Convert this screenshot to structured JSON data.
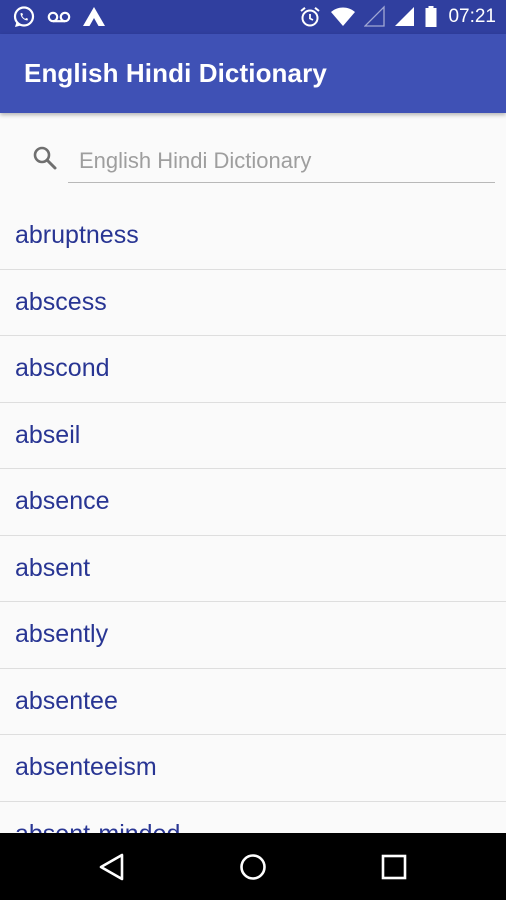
{
  "status_bar": {
    "time": "07:21",
    "left_icons": [
      "whatsapp-icon",
      "voicemail-icon",
      "airdroid-icon"
    ],
    "right_icons": [
      "alarm-icon",
      "wifi-icon",
      "signal-empty-icon",
      "signal-icon",
      "battery-icon"
    ]
  },
  "app_bar": {
    "title": "English Hindi Dictionary",
    "color": "#3f51b5",
    "status_color": "#303f9f"
  },
  "search": {
    "placeholder": "English Hindi Dictionary",
    "value": "",
    "icon": "search-icon"
  },
  "words": [
    "abruptness",
    "abscess",
    "abscond",
    "abseil",
    "absence",
    "absent",
    "absently",
    "absentee",
    "absenteeism",
    "absent-minded"
  ],
  "word_color": "#283593",
  "nav_bar": {
    "buttons": [
      "back-icon",
      "home-icon",
      "recents-icon"
    ]
  }
}
